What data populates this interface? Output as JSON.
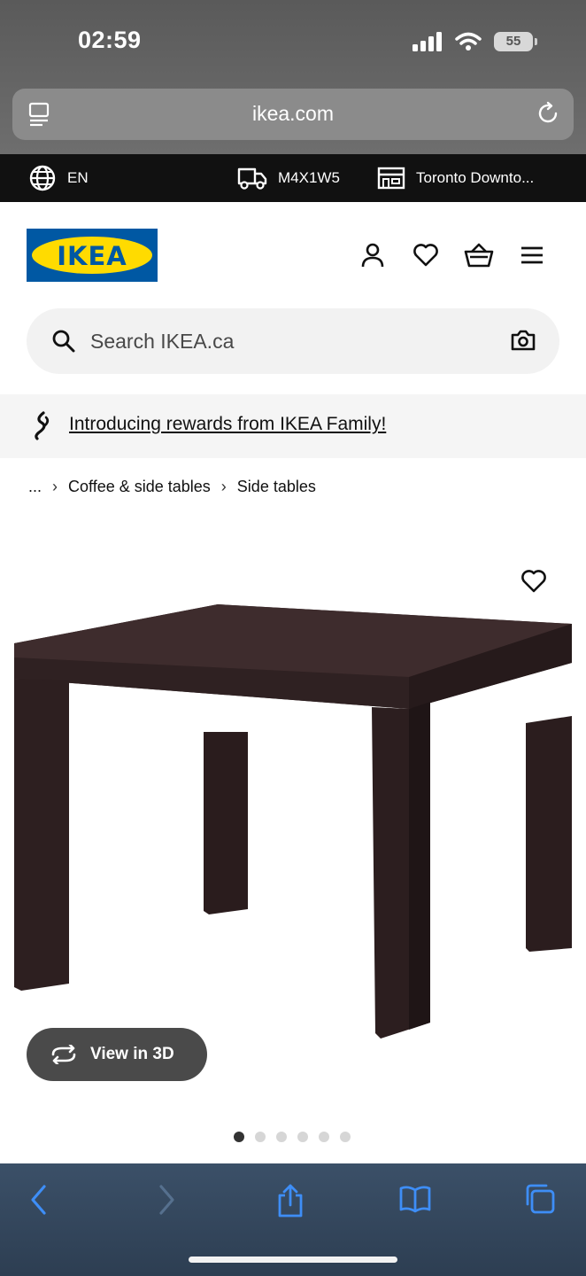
{
  "status_bar": {
    "time": "02:59",
    "battery": "55"
  },
  "browser": {
    "url": "ikea.com"
  },
  "info_strip": {
    "language": "EN",
    "postal_code": "M4X1W5",
    "store": "Toronto Downto..."
  },
  "header": {
    "logo_text": "IKEA"
  },
  "search": {
    "placeholder": "Search IKEA.ca"
  },
  "rewards": {
    "text": "Introducing rewards from IKEA Family!"
  },
  "breadcrumb": {
    "ellipsis": "...",
    "items": [
      "Coffee & side tables",
      "Side tables"
    ]
  },
  "product": {
    "view_3d_label": "View in 3D",
    "image_count": 6,
    "active_image": 1
  },
  "colors": {
    "ikea_blue": "#0058a3",
    "ikea_yellow": "#ffdb00",
    "table_color": "#2e2020"
  }
}
